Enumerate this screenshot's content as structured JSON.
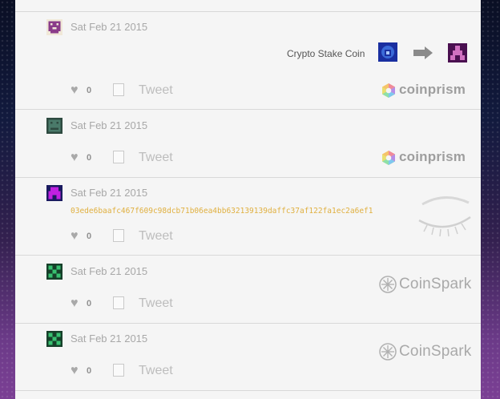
{
  "posts": [
    {
      "date": "Sat Feb 21 2015",
      "asset_name": "Crypto Stake Coin",
      "likes": "0",
      "tweet": "Tweet",
      "brand": "coinprism",
      "avatar_color": "#8a3c8a"
    },
    {
      "date": "Sat Feb 21 2015",
      "likes": "0",
      "tweet": "Tweet",
      "brand": "coinprism",
      "avatar_color": "#4a7a6a"
    },
    {
      "date": "Sat Feb 21 2015",
      "hash": "03ede6baafc467f609c98dcb71b06ea4bb632139139daffc37af122fa1ec2a6ef1",
      "likes": "0",
      "tweet": "Tweet",
      "avatar_color": "#9a22c0"
    },
    {
      "date": "Sat Feb 21 2015",
      "likes": "0",
      "tweet": "Tweet",
      "brand": "CoinSpark",
      "avatar_color": "#2a9a55"
    },
    {
      "date": "Sat Feb 21 2015",
      "likes": "0",
      "tweet": "Tweet",
      "brand": "CoinSpark",
      "avatar_color": "#2a9a55"
    }
  ],
  "colors": {
    "hash_text": "#e0b040",
    "date_text": "#a8a8a8",
    "panel_bg": "#f5f5f5"
  },
  "icons": [
    "heart-icon",
    "arrow-right-icon",
    "eye-closed-icon",
    "coinprism-logo-icon",
    "coinspark-logo-icon"
  ]
}
